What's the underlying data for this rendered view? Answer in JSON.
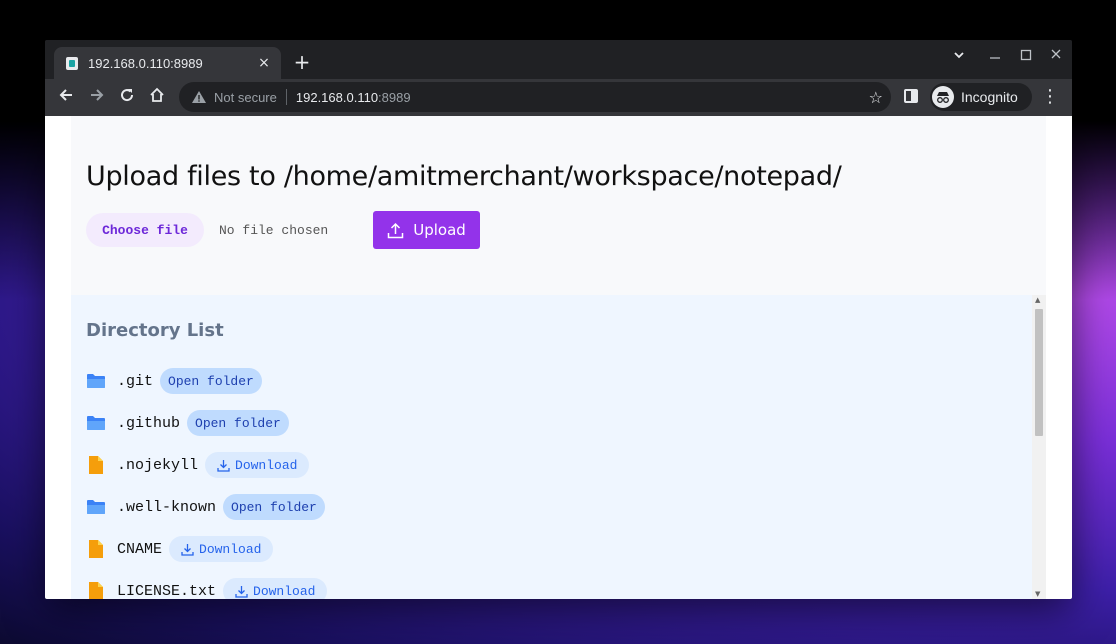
{
  "browser": {
    "tab_title": "192.168.0.110:8989",
    "new_tab": "+",
    "close_tab": "×",
    "url_security": "Not secure",
    "url_host": "192.168.0.110",
    "url_port": ":8989",
    "incognito_label": "Incognito"
  },
  "upload": {
    "title": "Upload files to /home/amitmerchant/workspace/notepad/",
    "choose_file_label": "Choose file",
    "no_file_text": "No file chosen",
    "upload_label": "Upload",
    "accent_color": "#9333ea"
  },
  "directory": {
    "title": "Directory List",
    "items": [
      {
        "name": ".git",
        "type": "folder",
        "action": "Open folder"
      },
      {
        "name": ".github",
        "type": "folder",
        "action": "Open folder"
      },
      {
        "name": ".nojekyll",
        "type": "file",
        "action": "Download"
      },
      {
        "name": ".well-known",
        "type": "folder",
        "action": "Open folder"
      },
      {
        "name": "CNAME",
        "type": "file",
        "action": "Download"
      },
      {
        "name": "LICENSE.txt",
        "type": "file",
        "action": "Download"
      }
    ]
  }
}
